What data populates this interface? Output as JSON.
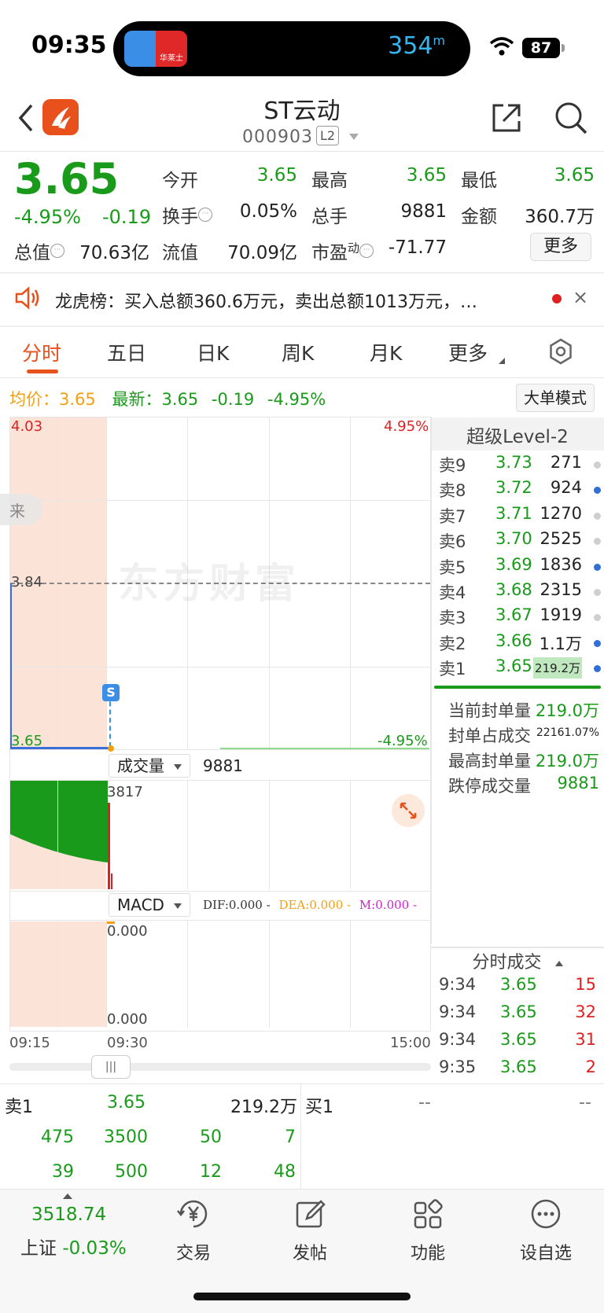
{
  "status_bar": {
    "time": "09:35",
    "distance": "354",
    "distance_unit": "m",
    "battery": "87",
    "island_app_text": "华莱士"
  },
  "header": {
    "stock_name": "ST云动",
    "stock_code": "000903",
    "level_badge": "L2"
  },
  "quote": {
    "price": "3.65",
    "change_pct": "-4.95%",
    "change": "-0.19",
    "open_label": "今开",
    "open": "3.65",
    "high_label": "最高",
    "high": "3.65",
    "low_label": "最低",
    "low": "3.65",
    "turnover_label": "换手",
    "turnover": "0.05%",
    "volume_label": "总手",
    "volume": "9881",
    "amount_label": "金额",
    "amount": "360.7万",
    "mktcap_label": "总值",
    "mktcap": "70.63亿",
    "float_label": "流值",
    "float_cap": "70.09亿",
    "pe_label": "市盈",
    "pe_sup": "动",
    "pe": "-71.77",
    "more_label": "更多"
  },
  "announcement": {
    "text": "龙虎榜：买入总额360.6万元，卖出总额1013万元，…",
    "close": "×"
  },
  "tabs": [
    "分时",
    "五日",
    "日K",
    "周K",
    "月K",
    "更多"
  ],
  "summary": {
    "avg_label": "均价：",
    "avg": "3.65",
    "latest_label": "最新：",
    "latest": "3.65",
    "change": "-0.19",
    "pct": "-4.95%",
    "bigorder_btn": "大单模式"
  },
  "chart": {
    "top_price": "4.03",
    "top_pct": "4.95%",
    "mid_price": "3.84",
    "bottom_price": "3.65",
    "bottom_pct": "-4.95%",
    "watermark": "东方财富",
    "side_tag": "来",
    "marker": "S",
    "volume_dropdown": "成交量",
    "volume_value": "9881",
    "volume_max": "3817",
    "macd_dropdown": "MACD",
    "dif": "DIF:0.000 -",
    "dea": "DEA:0.000 -",
    "m": "M:0.000 -",
    "macd_top": "0.000",
    "macd_bottom": "0.000",
    "time_start": "09:15",
    "time_open": "09:30",
    "time_end": "15:00",
    "colors": {
      "down": "#1a9a1a",
      "up": "#e02020",
      "avg": "#f2a012",
      "pre_market": "#fce3d8"
    }
  },
  "order_book": {
    "title": "超级Level-2",
    "asks": [
      {
        "label": "卖9",
        "price": "3.73",
        "volume": "271",
        "dot": "gray"
      },
      {
        "label": "卖8",
        "price": "3.72",
        "volume": "924",
        "dot": "blue"
      },
      {
        "label": "卖7",
        "price": "3.71",
        "volume": "1270",
        "dot": "gray"
      },
      {
        "label": "卖6",
        "price": "3.70",
        "volume": "2525",
        "dot": "gray"
      },
      {
        "label": "卖5",
        "price": "3.69",
        "volume": "1836",
        "dot": "blue"
      },
      {
        "label": "卖4",
        "price": "3.68",
        "volume": "2315",
        "dot": "gray"
      },
      {
        "label": "卖3",
        "price": "3.67",
        "volume": "1919",
        "dot": "gray"
      },
      {
        "label": "卖2",
        "price": "3.66",
        "volume": "1.1万",
        "dot": "blue"
      },
      {
        "label": "卖1",
        "price": "3.65",
        "volume": "219.2万",
        "dot": "blue"
      }
    ],
    "seal": [
      {
        "label": "当前封单量",
        "value": "219.0万"
      },
      {
        "label": "封单占成交",
        "value": "22161.07%"
      },
      {
        "label": "最高封单量",
        "value": "219.0万"
      },
      {
        "label": "跌停成交量",
        "value": "9881"
      }
    ]
  },
  "trades": {
    "title": "分时成交",
    "rows": [
      {
        "time": "9:34",
        "price": "3.65",
        "volume": "15"
      },
      {
        "time": "9:34",
        "price": "3.65",
        "volume": "32"
      },
      {
        "time": "9:34",
        "price": "3.65",
        "volume": "31"
      },
      {
        "time": "9:35",
        "price": "3.65",
        "volume": "2"
      }
    ]
  },
  "bottom_book": {
    "sell_label": "卖1",
    "sell_price": "3.65",
    "sell_volume": "219.2万",
    "buy_label": "买1",
    "buy_price": "--",
    "buy_volume": "--",
    "row1": [
      "475",
      "3500",
      "50",
      "7"
    ],
    "row2": [
      "39",
      "500",
      "12",
      "48"
    ]
  },
  "bottom_nav": {
    "index_value": "3518.74",
    "index_name": "上证",
    "index_pct": "-0.03%",
    "items": [
      {
        "label": "交易",
        "icon": "yen-icon"
      },
      {
        "label": "发帖",
        "icon": "edit-icon"
      },
      {
        "label": "功能",
        "icon": "grid-icon"
      },
      {
        "label": "设自选",
        "icon": "more-icon"
      }
    ]
  }
}
